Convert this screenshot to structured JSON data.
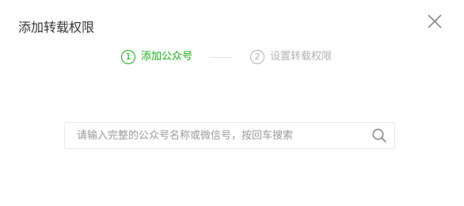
{
  "dialog": {
    "title": "添加转载权限",
    "close_icon": "close-icon"
  },
  "steps": [
    {
      "number": "1",
      "label": "添加公众号",
      "state": "active"
    },
    {
      "number": "2",
      "label": "设置转载权限",
      "state": "inactive"
    }
  ],
  "search": {
    "value": "",
    "placeholder": "请输入完整的公众号名称或微信号，按回车搜索",
    "icon": "search-icon"
  },
  "colors": {
    "accent": "#1aad19",
    "inactive": "#b2b2b2",
    "title_text": "#353535",
    "placeholder": "#9a9a9a",
    "border": "#e4e8eb"
  }
}
